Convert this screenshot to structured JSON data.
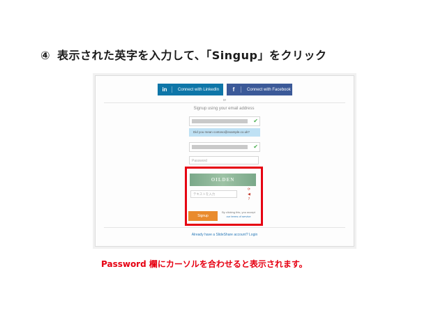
{
  "heading": {
    "number": "④",
    "text": "表示された英字を入力して、「Singup」をクリック"
  },
  "screenshot": {
    "linkedin_label": "Connect with LinkedIn",
    "facebook_label": "Connect with Facebook",
    "or_text": "or",
    "signup_using": "Signup using your email address",
    "suggestion": "Did you mean contoso@example.co.uk?",
    "password_placeholder": "Password",
    "captcha_word": "OILDEN",
    "captcha_placeholder": "テキストを入力",
    "signup_label": "Signup",
    "terms_line1": "By clicking this, you accept",
    "terms_line2": "our terms of service",
    "already_text": "Already have a SlideShare account? Login"
  },
  "caption": "Password 欄にカーソルを合わせると表示されます。",
  "colors": {
    "highlight": "#e60012",
    "linkedin": "#0e76a8",
    "facebook": "#3b5998",
    "signup": "#e98b2d"
  }
}
